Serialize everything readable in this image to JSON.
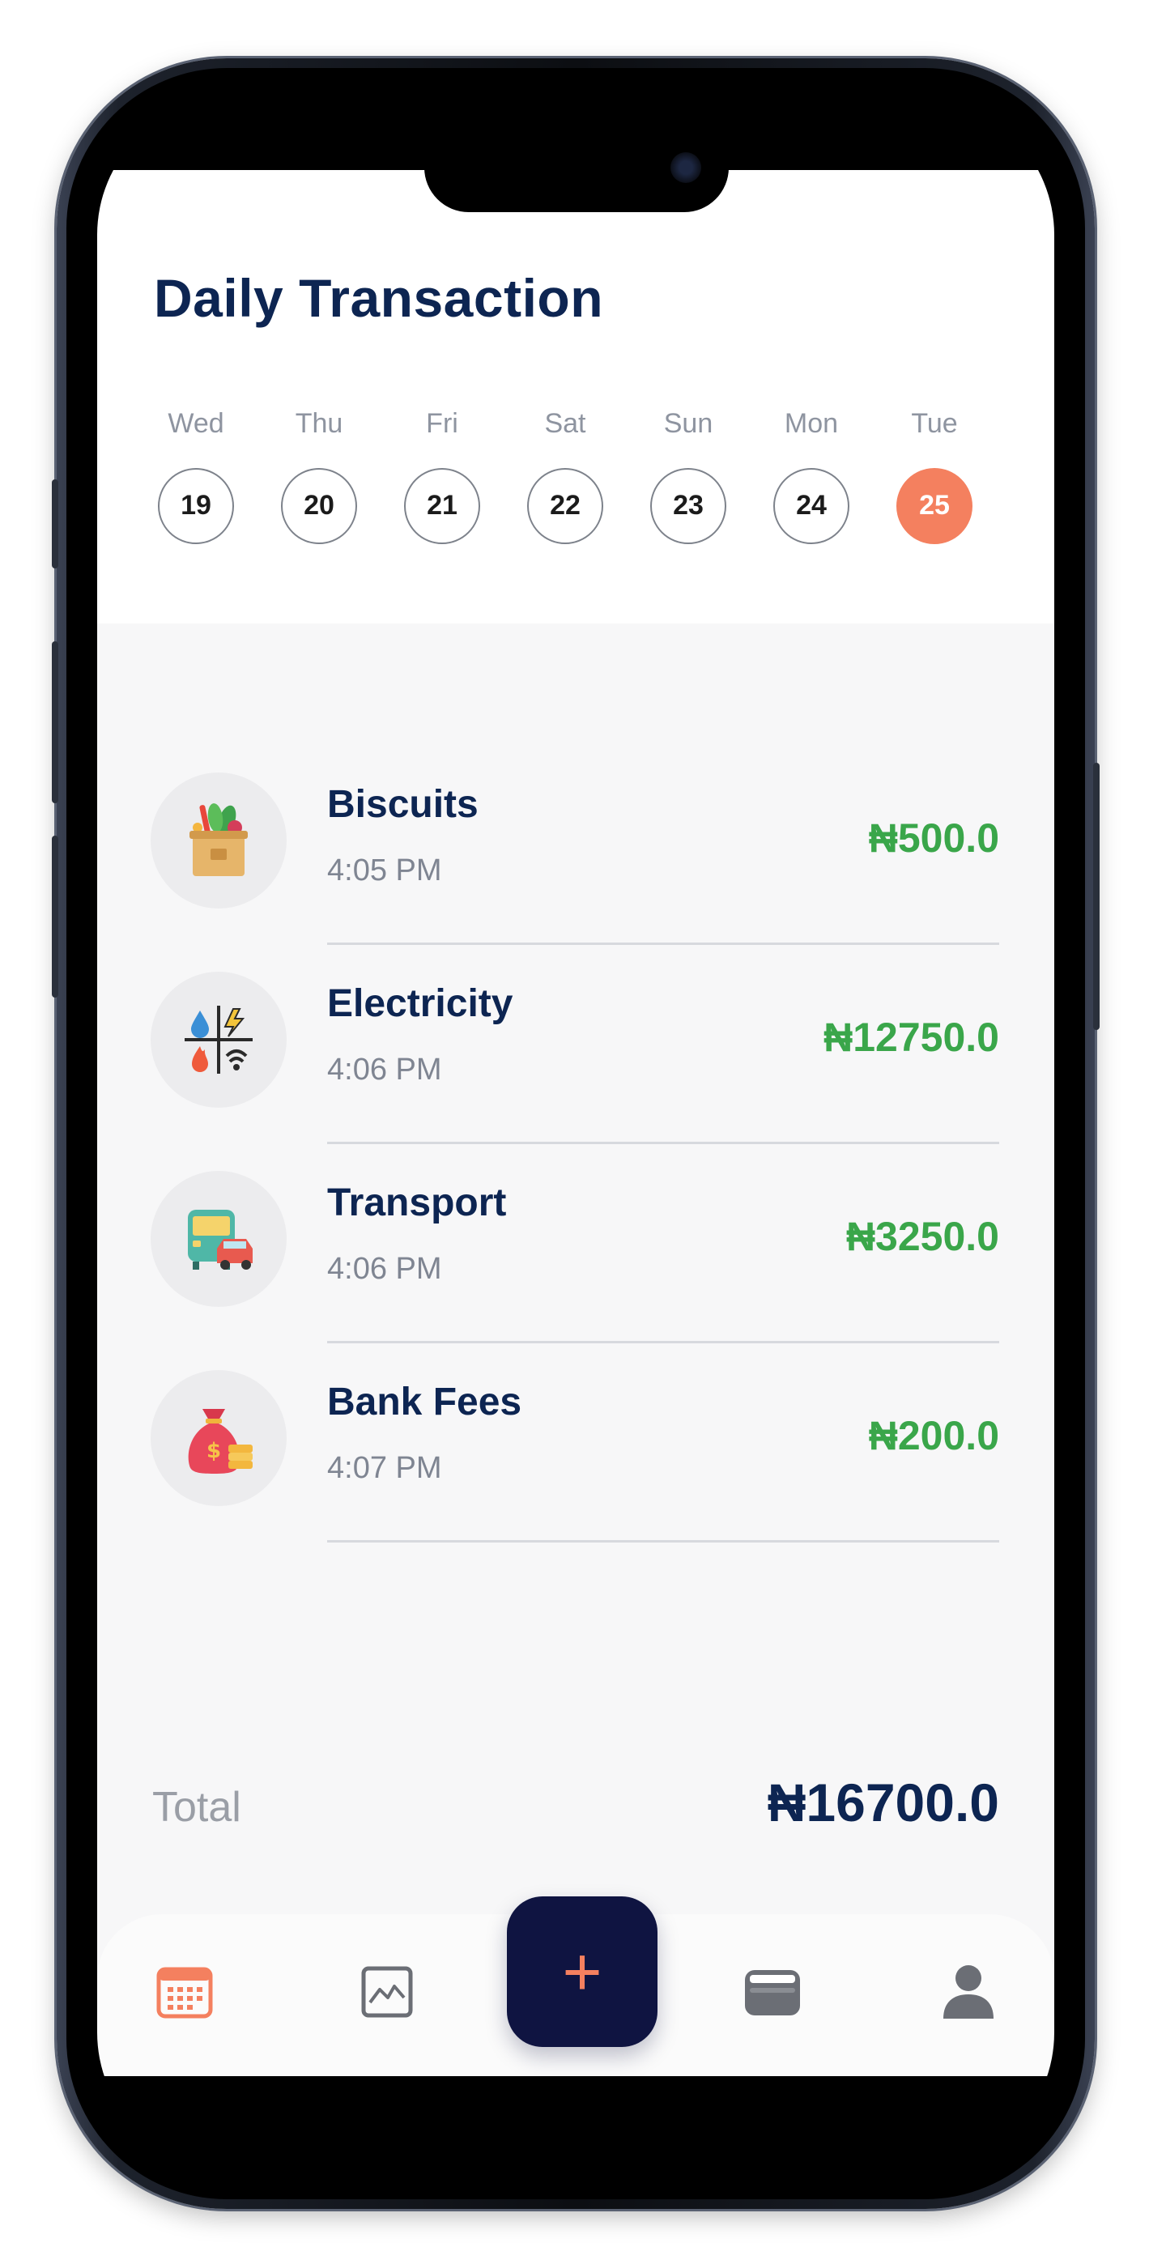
{
  "header": {
    "title": "Daily Transaction"
  },
  "days": [
    {
      "name": "Wed",
      "date": "19",
      "active": false
    },
    {
      "name": "Thu",
      "date": "20",
      "active": false
    },
    {
      "name": "Fri",
      "date": "21",
      "active": false
    },
    {
      "name": "Sat",
      "date": "22",
      "active": false
    },
    {
      "name": "Sun",
      "date": "23",
      "active": false
    },
    {
      "name": "Mon",
      "date": "24",
      "active": false
    },
    {
      "name": "Tue",
      "date": "25",
      "active": true
    }
  ],
  "transactions": [
    {
      "name": "Biscuits",
      "time": "4:05 PM",
      "amount": "₦500.0",
      "icon": "grocery-bag-icon"
    },
    {
      "name": "Electricity",
      "time": "4:06 PM",
      "amount": "₦12750.0",
      "icon": "utilities-icon"
    },
    {
      "name": "Transport",
      "time": "4:06 PM",
      "amount": "₦3250.0",
      "icon": "bus-car-icon"
    },
    {
      "name": "Bank Fees",
      "time": "4:07 PM",
      "amount": "₦200.0",
      "icon": "money-bag-icon"
    }
  ],
  "summary": {
    "label": "Total",
    "value": "₦16700.0"
  },
  "fab": {
    "label": "+"
  },
  "nav": {
    "items": [
      {
        "icon": "calendar-icon",
        "active": true
      },
      {
        "icon": "chart-icon",
        "active": false
      },
      {
        "icon": "wallet-icon",
        "active": false
      },
      {
        "icon": "profile-icon",
        "active": false
      }
    ]
  },
  "colors": {
    "accent": "#f4805f",
    "title": "#0d2552",
    "amount": "#3aa64a",
    "fab": "#0f1441"
  }
}
